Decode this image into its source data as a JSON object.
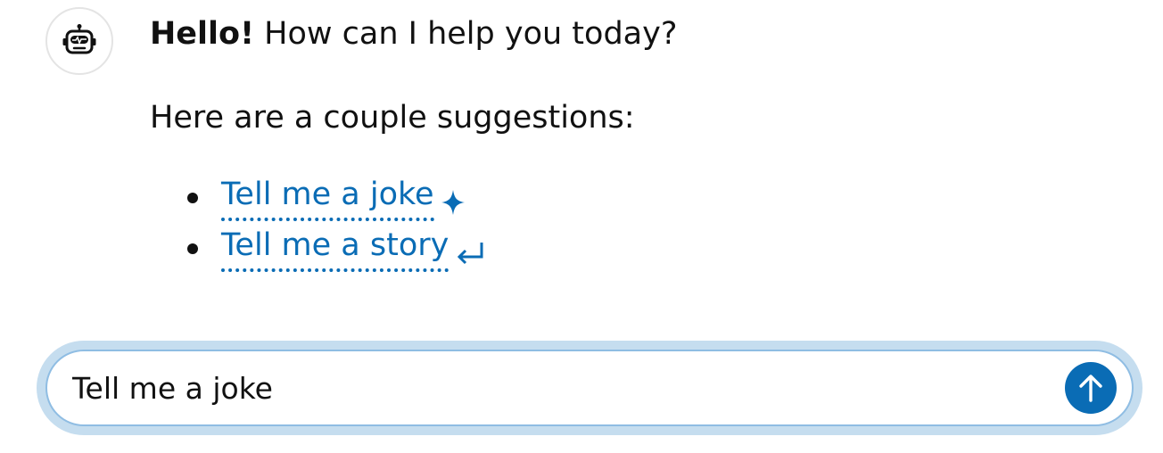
{
  "assistant": {
    "avatar_icon": "robot-icon"
  },
  "message": {
    "greeting_bold": "Hello!",
    "greeting_rest": " How can I help you today?",
    "intro": "Here are a couple suggestions:",
    "suggestions": [
      {
        "label": "Tell me a joke",
        "icon": "sparkle-icon"
      },
      {
        "label": "Tell me a story",
        "icon": "enter-icon"
      }
    ]
  },
  "composer": {
    "value": "Tell me a joke",
    "send_icon": "arrow-up-icon"
  },
  "colors": {
    "accent": "#0a6cb5",
    "input_halo": "#c5ddef",
    "input_border": "#8fbde3",
    "text": "#111111"
  }
}
